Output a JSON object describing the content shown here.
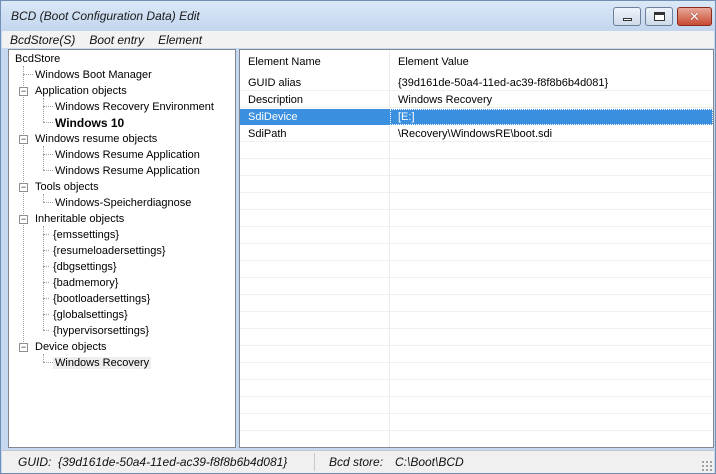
{
  "window": {
    "title": "BCD (Boot Configuration Data) Edit",
    "controls": {
      "minimize": "minimize",
      "maximize": "maximize",
      "close": "✕"
    }
  },
  "menubar": {
    "items": [
      "BcdStore(S)",
      "Boot entry",
      "Element"
    ]
  },
  "tree": {
    "root": "BcdStore",
    "nodes": {
      "boot_manager": "Windows Boot Manager",
      "application_objects": "Application objects",
      "recovery_env": "Windows Recovery Environment",
      "windows10": "Windows 10",
      "resume_objects": "Windows resume objects",
      "resume_app_1": "Windows Resume Application",
      "resume_app_2": "Windows Resume Application",
      "tools_objects": "Tools objects",
      "speicherdiagnose": "Windows-Speicherdiagnose",
      "inheritable_objects": "Inheritable objects",
      "emssettings": "{emssettings}",
      "resumeloadersettings": "{resumeloadersettings}",
      "dbgsettings": "{dbgsettings}",
      "badmemory": "{badmemory}",
      "bootloadersettings": "{bootloadersettings}",
      "globalsettings": "{globalsettings}",
      "hypervisorsettings": "{hypervisorsettings}",
      "device_objects": "Device objects",
      "windows_recovery": "Windows Recovery"
    },
    "toggle_symbol": "−"
  },
  "details": {
    "columns": [
      "Element Name",
      "Element Value"
    ],
    "rows": [
      {
        "name": "GUID alias",
        "value": "{39d161de-50a4-11ed-ac39-f8f8b6b4d081}"
      },
      {
        "name": "Description",
        "value": "Windows Recovery"
      },
      {
        "name": "SdiDevice",
        "value": "[E:]"
      },
      {
        "name": "SdiPath",
        "value": "\\Recovery\\WindowsRE\\boot.sdi"
      }
    ],
    "selected_row": 2
  },
  "status": {
    "guid_label": "GUID:",
    "guid_value": "{39d161de-50a4-11ed-ac39-f8f8b6b4d081}",
    "store_label": "Bcd store:",
    "store_value": "C:\\Boot\\BCD"
  },
  "colors": {
    "selection": "#3a8fde",
    "frame": "#c7d9f0",
    "close_button": "#c84a33"
  }
}
